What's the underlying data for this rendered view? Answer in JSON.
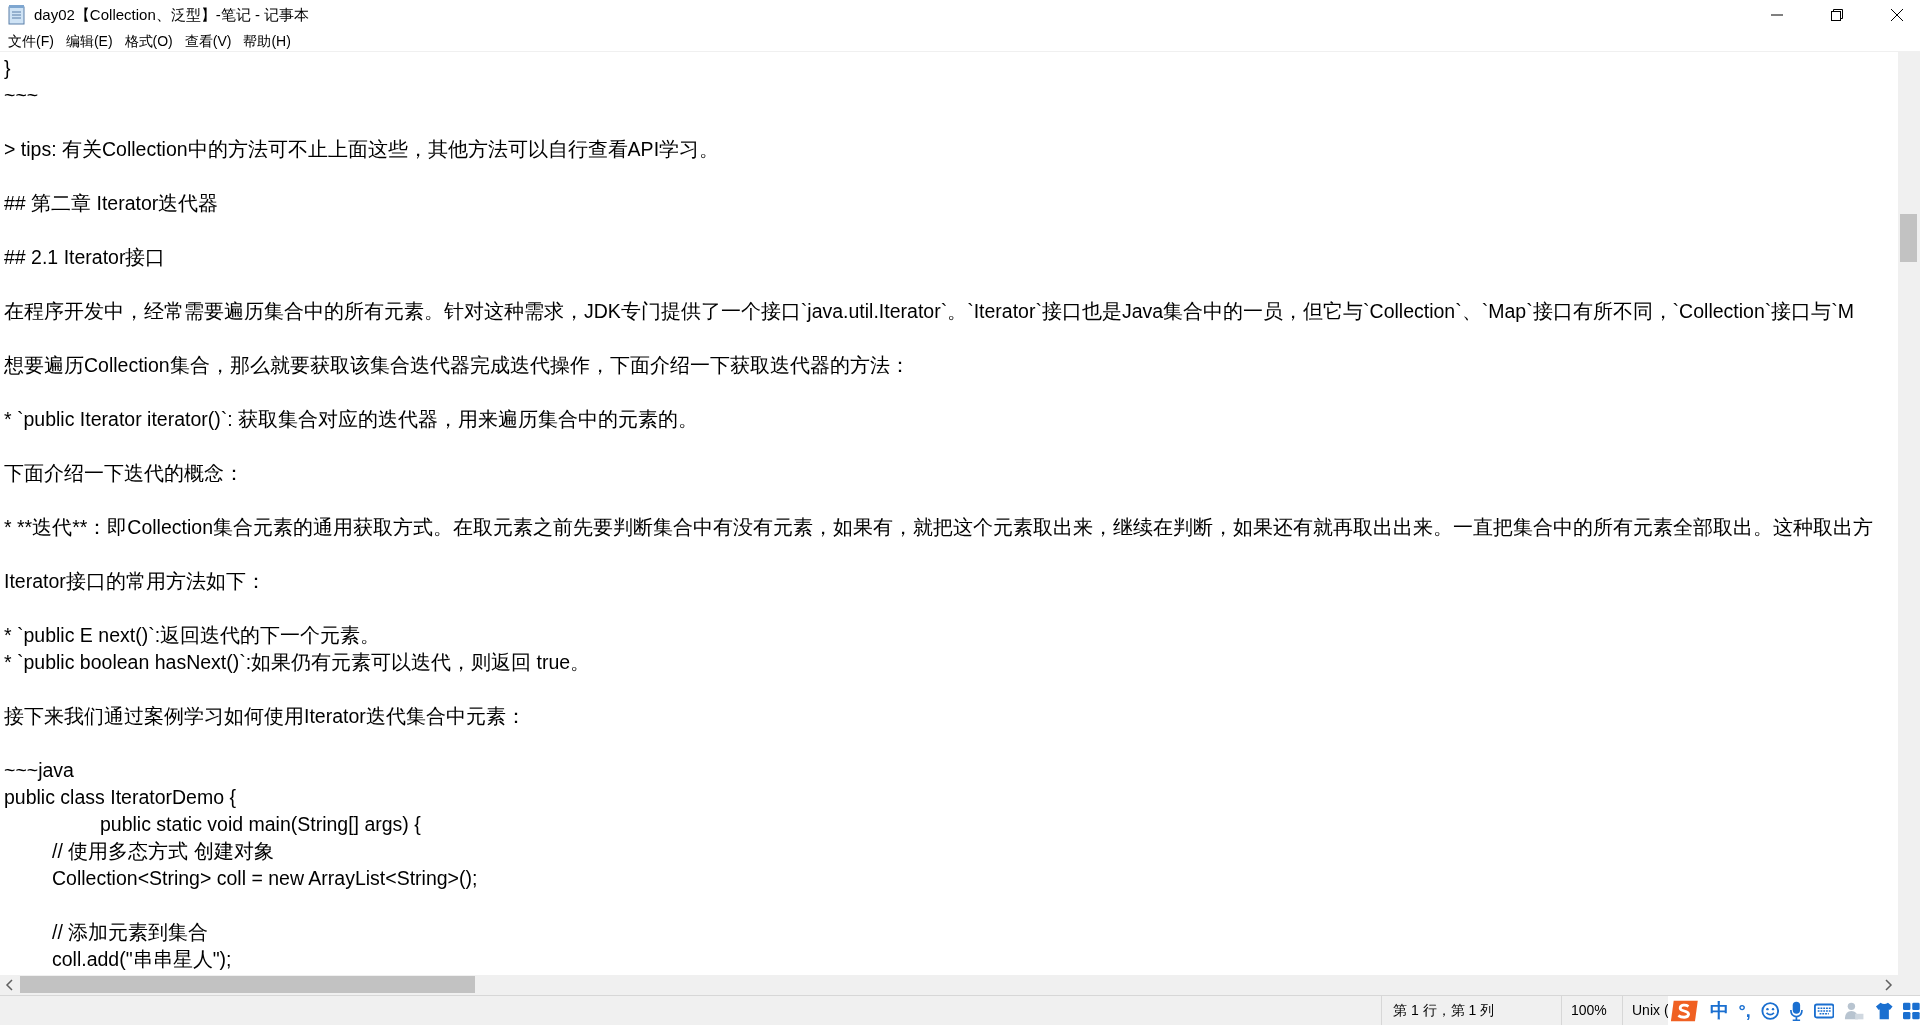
{
  "window": {
    "title": "day02【Collection、泛型】-笔记 - 记事本"
  },
  "menu": [
    "文件(F)",
    "编辑(E)",
    "格式(O)",
    "查看(V)",
    "帮助(H)"
  ],
  "editor": {
    "paragraphs": [
      {
        "lines": [
          "}",
          "~~~"
        ]
      },
      {
        "lines": [
          "> tips: 有关Collection中的方法可不止上面这些，其他方法可以自行查看API学习。"
        ]
      },
      {
        "lines": [
          "## 第二章 Iterator迭代器"
        ]
      },
      {
        "lines": [
          "## 2.1 Iterator接口"
        ]
      },
      {
        "lines": [
          "在程序开发中，经常需要遍历集合中的所有元素。针对这种需求，JDK专门提供了一个接口`java.util.Iterator`。`Iterator`接口也是Java集合中的一员，但它与`Collection`、`Map`接口有所不同，`Collection`接口与`M"
        ]
      },
      {
        "lines": [
          "想要遍历Collection集合，那么就要获取该集合迭代器完成迭代操作，下面介绍一下获取迭代器的方法："
        ]
      },
      {
        "lines": [
          "* `public Iterator iterator()`: 获取集合对应的迭代器，用来遍历集合中的元素的。"
        ]
      },
      {
        "lines": [
          "下面介绍一下迭代的概念："
        ]
      },
      {
        "lines": [
          "* **迭代**：即Collection集合元素的通用获取方式。在取元素之前先要判断集合中有没有元素，如果有，就把这个元素取出来，继续在判断，如果还有就再取出出来。一直把集合中的所有元素全部取出。这种取出方"
        ]
      },
      {
        "lines": [
          "Iterator接口的常用方法如下："
        ]
      },
      {
        "lines": [
          "* `public E next()`:返回迭代的下一个元素。",
          "* `public boolean hasNext()`:如果仍有元素可以迭代，则返回 true。"
        ]
      },
      {
        "lines": [
          "接下来我们通过案例学习如何使用Iterator迭代集合中元素："
        ]
      },
      {
        "lines": [
          "~~~java",
          "public class IteratorDemo {",
          "\t\tpublic static void main(String[] args) {",
          "\t// 使用多态方式 创建对象",
          "\tCollection<String> coll = new ArrayList<String>();"
        ]
      },
      {
        "lines": [
          "\t// 添加元素到集合",
          "\tcoll.add(\"串串星人\");"
        ]
      }
    ]
  },
  "status_bar": {
    "position": "第 1 行，第 1 列",
    "zoom": "100%",
    "line_ending": "Unix ("
  },
  "ime_toolbar": {
    "mode": "中",
    "punctuation": "°,"
  }
}
